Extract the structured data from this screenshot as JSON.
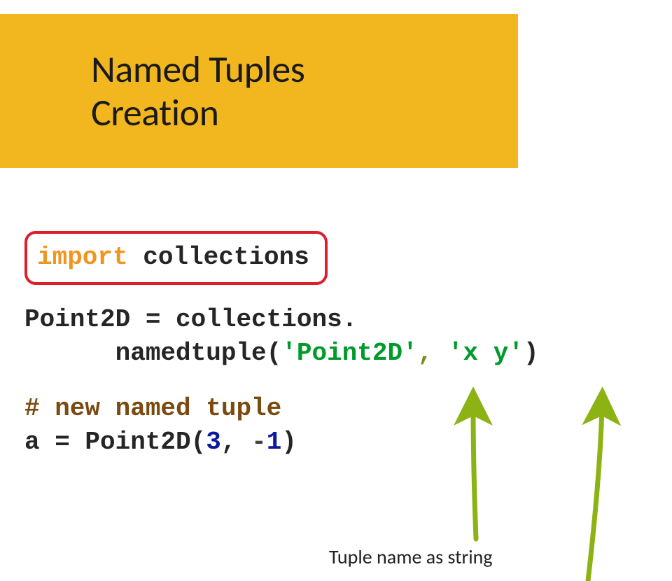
{
  "title": {
    "line1": "Named Tuples",
    "line2": "Creation"
  },
  "code": {
    "import_kw": "import",
    "import_module": " collections",
    "line1_a": "Point2D = collections.",
    "line2_a": "      namedtuple(",
    "line2_str1": "'Point2D'",
    "line2_mid": ", ",
    "line2_str2": "'x y'",
    "line2_end": ")",
    "line3_comment": "# new named tuple",
    "line4_a": "a = Point2D(",
    "line4_n1": "3",
    "line4_mid": ", ",
    "line4_neg": "-",
    "line4_n2": "1",
    "line4_end": ")"
  },
  "annotation": {
    "label": "Tuple name as string"
  },
  "colors": {
    "title_bg": "#f2b71e",
    "highlight_border": "#dc1f2d",
    "keyword": "#f0951f",
    "string": "#009a2b",
    "olive": "#7a8a1f",
    "comment": "#7a4a10",
    "number": "#0a1a9c",
    "arrow": "#8db214"
  }
}
